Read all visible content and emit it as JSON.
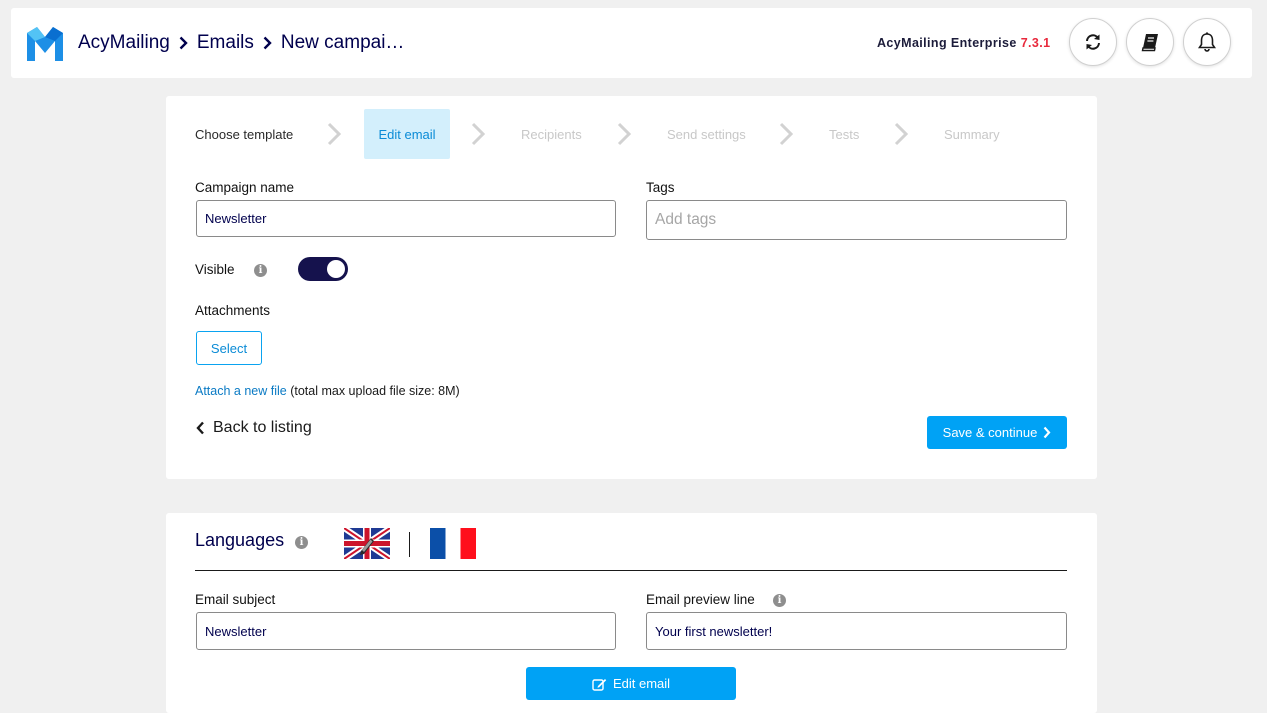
{
  "header": {
    "app_name": "AcyMailing",
    "breadcrumb": [
      "AcyMailing",
      "Emails",
      "New campai…"
    ],
    "edition": "AcyMailing Enterprise",
    "version": "7.3.1",
    "buttons": [
      {
        "name": "refresh-icon"
      },
      {
        "name": "documentation-book-icon"
      },
      {
        "name": "notifications-bell-icon"
      }
    ]
  },
  "steps": [
    {
      "label": "Choose template",
      "state": "done"
    },
    {
      "label": "Edit email",
      "state": "active"
    },
    {
      "label": "Recipients",
      "state": "disabled"
    },
    {
      "label": "Send settings",
      "state": "disabled"
    },
    {
      "label": "Tests",
      "state": "disabled"
    },
    {
      "label": "Summary",
      "state": "disabled"
    }
  ],
  "form": {
    "campaign_name_label": "Campaign name",
    "campaign_name_value": "Newsletter",
    "tags_label": "Tags",
    "tags_placeholder": "Add tags",
    "visible_label": "Visible",
    "visible_on": true,
    "attachments_label": "Attachments",
    "select_button": "Select",
    "attach_link": "Attach a new file",
    "attach_note": " (total max upload file size: 8M)",
    "back_label": "Back to listing",
    "save_label": "Save & continue"
  },
  "languages": {
    "title": "Languages",
    "flags": [
      "uk-flag-icon",
      "france-flag-icon"
    ],
    "subject_label": "Email subject",
    "subject_value": "Newsletter",
    "preview_label": "Email preview line",
    "preview_value": "Your first newsletter!",
    "edit_button": "Edit email"
  },
  "colors": {
    "accent": "#00a2f5",
    "brand_dark": "#00004d",
    "toggle": "#15124d",
    "version_red": "#e8293c"
  }
}
